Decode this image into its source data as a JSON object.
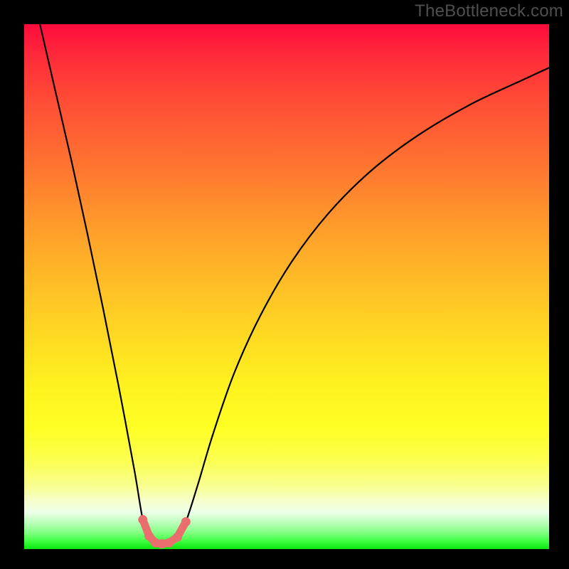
{
  "watermark": "TheBottleneck.com",
  "chart_data": {
    "type": "line",
    "title": "",
    "xlabel": "",
    "ylabel": "",
    "xlim": [
      0,
      1
    ],
    "ylim": [
      0,
      1
    ],
    "grid": false,
    "legend": false,
    "series": [
      {
        "name": "curve",
        "color": "#000000",
        "x": [
          0.03,
          0.06,
          0.09,
          0.12,
          0.15,
          0.18,
          0.21,
          0.226,
          0.238,
          0.25,
          0.262,
          0.276,
          0.292,
          0.308,
          0.33,
          0.36,
          0.4,
          0.45,
          0.51,
          0.58,
          0.66,
          0.75,
          0.85,
          0.95,
          1.0
        ],
        "y": [
          1.0,
          0.87,
          0.74,
          0.603,
          0.46,
          0.31,
          0.15,
          0.056,
          0.025,
          0.012,
          0.01,
          0.012,
          0.023,
          0.052,
          0.12,
          0.22,
          0.335,
          0.445,
          0.548,
          0.64,
          0.72,
          0.788,
          0.847,
          0.894,
          0.917
        ]
      },
      {
        "name": "markers",
        "color": "#e96e6d",
        "x": [
          0.226,
          0.238,
          0.25,
          0.262,
          0.276,
          0.292,
          0.308
        ],
        "y": [
          0.056,
          0.025,
          0.012,
          0.01,
          0.012,
          0.023,
          0.052
        ]
      }
    ]
  }
}
